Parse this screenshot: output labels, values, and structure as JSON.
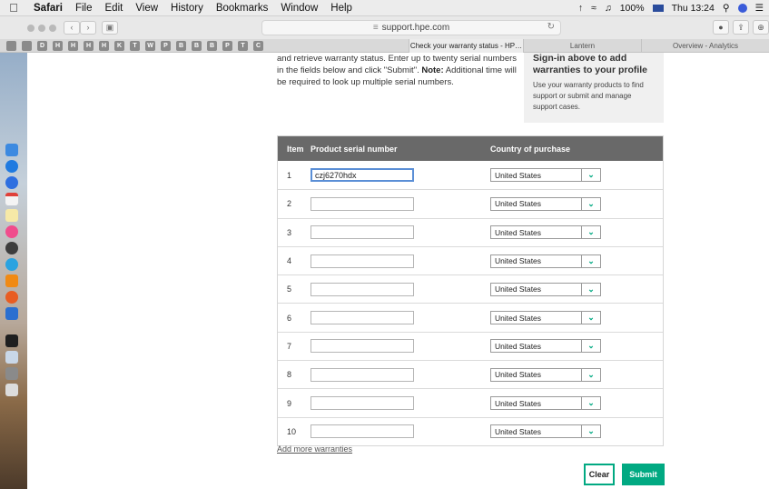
{
  "menubar": {
    "apple": "",
    "app": "Safari",
    "items": [
      "File",
      "Edit",
      "View",
      "History",
      "Bookmarks",
      "Window",
      "Help"
    ],
    "battery": "100%",
    "clock": "Thu 13:24"
  },
  "toolbar": {
    "url": "support.hpe.com"
  },
  "tabs": {
    "bookmark_letters": [
      "",
      "",
      "D",
      "H",
      "H",
      "H",
      "H",
      "K",
      "T",
      "W",
      "P",
      "B",
      "B",
      "B",
      "P",
      "T",
      "C"
    ],
    "items": [
      "Check your warranty status - HP…",
      "Lantern",
      "Overview - Analytics"
    ]
  },
  "page": {
    "intro_line1": "and retrieve warranty status. Enter up to twenty serial numbers",
    "intro_line2a": "in the fields below and click \"Submit\".",
    "intro_note": "Note:",
    "intro_line2b": " Additional time will",
    "intro_line3": "be required to look up multiple serial numbers.",
    "signin_title": "Sign-in above to add warranties to your profile",
    "signin_text": "Use your warranty products to find support or submit and manage support cases.",
    "table": {
      "col_item": "Item",
      "col_serial": "Product serial number",
      "col_country": "Country of purchase",
      "rows": [
        {
          "item": "1",
          "serial": "czj6270hdx",
          "country": "United States"
        },
        {
          "item": "2",
          "serial": "",
          "country": "United States"
        },
        {
          "item": "3",
          "serial": "",
          "country": "United States"
        },
        {
          "item": "4",
          "serial": "",
          "country": "United States"
        },
        {
          "item": "5",
          "serial": "",
          "country": "United States"
        },
        {
          "item": "6",
          "serial": "",
          "country": "United States"
        },
        {
          "item": "7",
          "serial": "",
          "country": "United States"
        },
        {
          "item": "8",
          "serial": "",
          "country": "United States"
        },
        {
          "item": "9",
          "serial": "",
          "country": "United States"
        },
        {
          "item": "10",
          "serial": "",
          "country": "United States"
        }
      ]
    },
    "add_more": "Add more warranties",
    "clear": "Clear",
    "submit": "Submit"
  },
  "colors": {
    "accent": "#01a982",
    "header_bg": "#696969"
  }
}
